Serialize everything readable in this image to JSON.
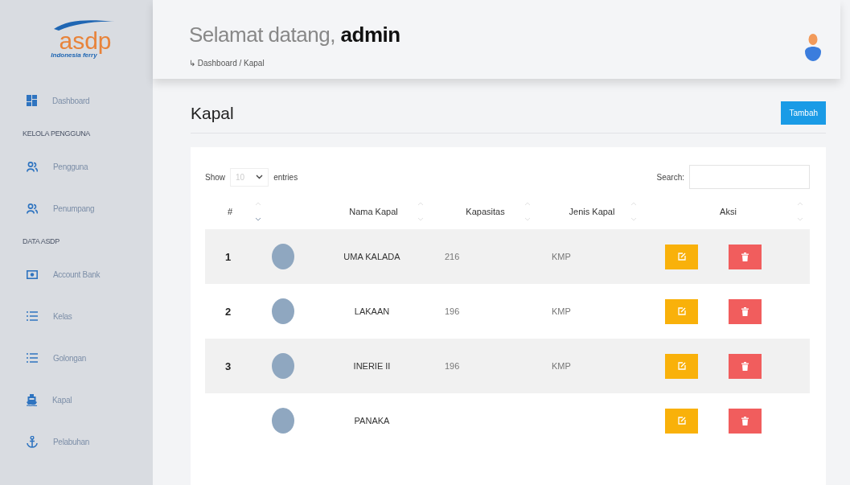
{
  "sidebar": {
    "logo": {
      "text": "asdp",
      "tagline": "Indonesia ferry"
    },
    "items": [
      {
        "kind": "dashboard",
        "label": "Dashboard"
      },
      {
        "kind": "heading",
        "label": "KELOLA PENGGUNA"
      },
      {
        "kind": "users",
        "label": "Pengguna"
      },
      {
        "kind": "users",
        "label": "Penumpang"
      },
      {
        "kind": "heading",
        "label": "DATA ASDP"
      },
      {
        "kind": "money",
        "label": "Account Bank"
      },
      {
        "kind": "list",
        "label": "Kelas"
      },
      {
        "kind": "list",
        "label": "Golongan"
      },
      {
        "kind": "ship",
        "label": "Kapal"
      },
      {
        "kind": "anchor",
        "label": "Pelabuhan"
      }
    ]
  },
  "header": {
    "greeting": "Selamat datang,",
    "user": "admin",
    "breadcrumb_arrow": "↳",
    "breadcrumb": "Dashboard / Kapal"
  },
  "page": {
    "title": "Kapal",
    "add_button": "Tambah"
  },
  "table_controls": {
    "show_label": "Show",
    "page_size": "10",
    "entries_label": "entries",
    "search_label": "Search:"
  },
  "table": {
    "columns": [
      {
        "label": "#",
        "sorted": true
      },
      {
        "label": "Nama Kapal",
        "sorted": false
      },
      {
        "label": "Kapasitas",
        "sorted": false
      },
      {
        "label": "Jenis Kapal",
        "sorted": false
      },
      {
        "label": "Aksi",
        "sorted": false
      }
    ],
    "rows": [
      {
        "number": "1",
        "name": "UMA KALADA",
        "capacity": "216",
        "type": "KMP"
      },
      {
        "number": "2",
        "name": "LAKAAN",
        "capacity": "196",
        "type": "KMP"
      },
      {
        "number": "3",
        "name": "INERIE II",
        "capacity": "196",
        "type": "KMP"
      },
      {
        "name": "PANAKA"
      }
    ]
  }
}
